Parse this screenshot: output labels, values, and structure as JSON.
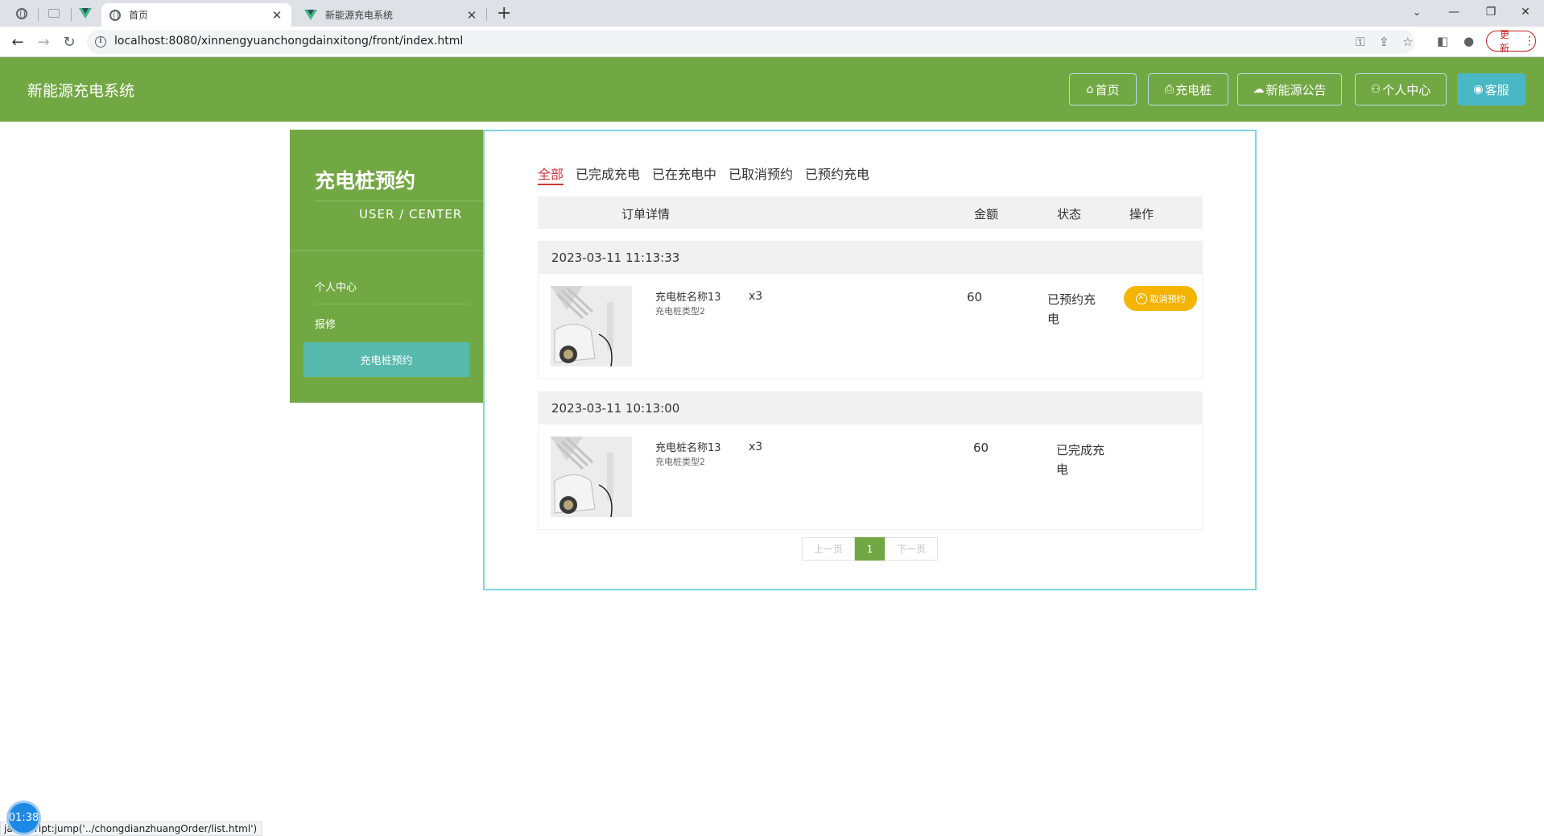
{
  "browser": {
    "tabs": [
      {
        "title": "首页",
        "active": true
      },
      {
        "title": "新能源充电系统",
        "active": false
      }
    ],
    "url": "localhost:8080/xinnengyuanchongdainxitong/front/index.html",
    "update_label": "更新",
    "status_text": "javascript:jump('../chongdianzhuangOrder/list.html')"
  },
  "header": {
    "site_title": "新能源充电系统",
    "nav": [
      {
        "label": "首页",
        "icon": "home-icon"
      },
      {
        "label": "充电桩",
        "icon": "printer-icon"
      },
      {
        "label": "新能源公告",
        "icon": "chat-icon"
      },
      {
        "label": "个人中心",
        "icon": "user-icon"
      },
      {
        "label": "客服",
        "icon": "service-icon"
      }
    ]
  },
  "sidebar": {
    "title": "充电桩预约",
    "subtitle": "USER / CENTER",
    "items": [
      {
        "label": "个人中心",
        "active": false
      },
      {
        "label": "报修",
        "active": false
      },
      {
        "label": "充电桩预约",
        "active": true
      }
    ]
  },
  "main": {
    "filters": [
      "全部",
      "已完成充电",
      "已在充电中",
      "已取消预约",
      "已预约充电"
    ],
    "active_filter": "全部",
    "columns": {
      "detail": "订单详情",
      "amount": "金额",
      "status": "状态",
      "action": "操作"
    },
    "orders": [
      {
        "date": "2023-03-11 11:13:33",
        "name": "充电桩名称13",
        "type": "充电桩类型2",
        "qty": "x3",
        "amount": "60",
        "status_line1": "已预约充",
        "status_line2": "电",
        "action": "取消预约"
      },
      {
        "date": "2023-03-11 10:13:00",
        "name": "充电桩名称13",
        "type": "充电桩类型2",
        "qty": "x3",
        "amount": "60",
        "status_line1": "已完成充",
        "status_line2": "电",
        "action": ""
      }
    ],
    "pagination": {
      "prev": "上一页",
      "current": "1",
      "next": "下一页"
    }
  },
  "overlay": {
    "timer": "01:38"
  },
  "colors": {
    "brand_green": "#72a843",
    "teal_active": "#58b9ad",
    "service_blue": "#49b8c4",
    "filter_red": "#d0363c",
    "cancel_orange": "#f5b400"
  }
}
